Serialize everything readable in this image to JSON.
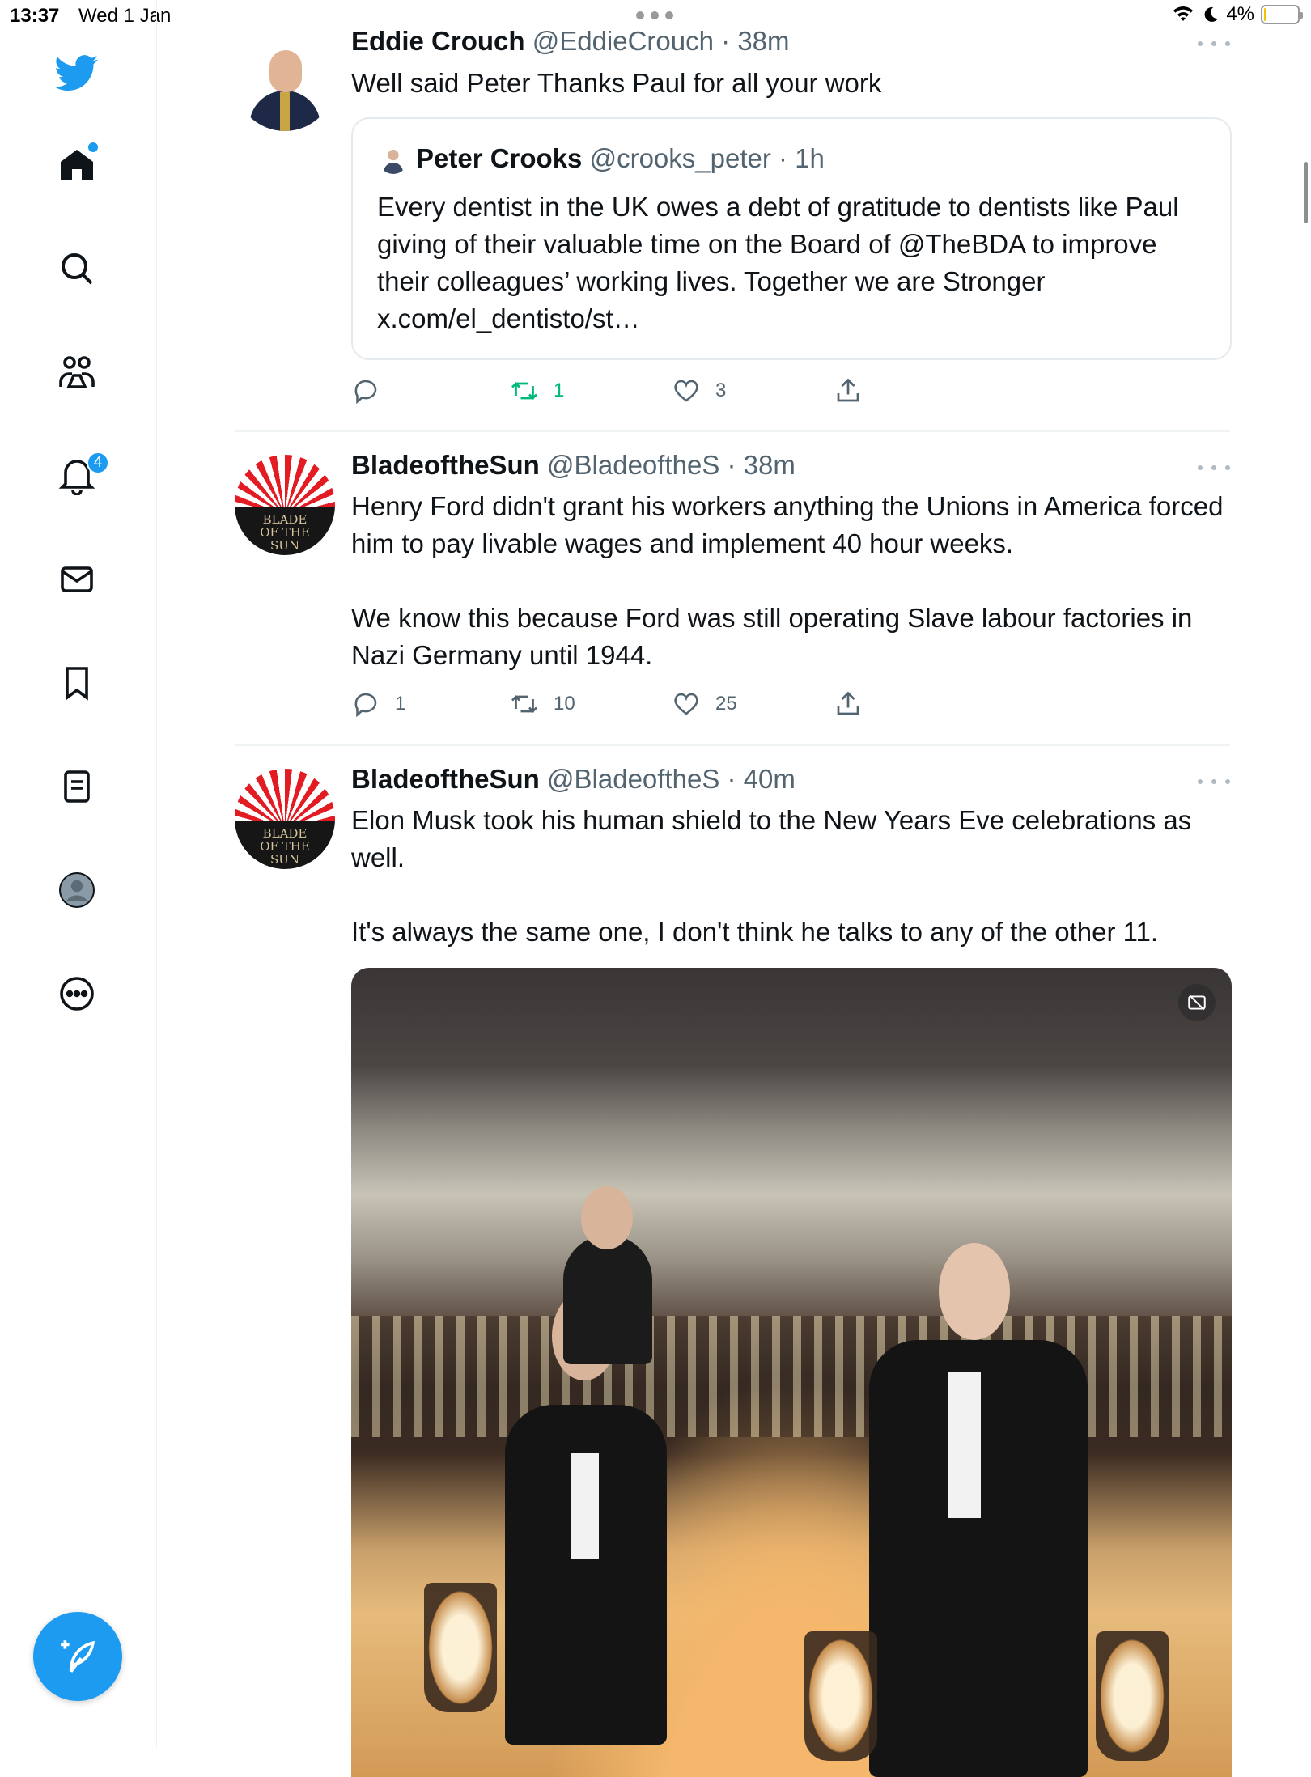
{
  "status_bar": {
    "time": "13:37",
    "date": "Wed 1 Jan",
    "battery": "4%",
    "battery_level": 0.04
  },
  "sidebar": {
    "notifications_badge": "4",
    "items": [
      {
        "name": "home",
        "icon": "home-icon"
      },
      {
        "name": "search",
        "icon": "search-icon"
      },
      {
        "name": "communities",
        "icon": "communities-icon"
      },
      {
        "name": "notifications",
        "icon": "bell-icon"
      },
      {
        "name": "messages",
        "icon": "mail-icon"
      },
      {
        "name": "bookmarks",
        "icon": "bookmark-icon"
      },
      {
        "name": "lists",
        "icon": "list-icon"
      },
      {
        "name": "profile",
        "icon": "profile-icon"
      },
      {
        "name": "more",
        "icon": "more-circle-icon"
      }
    ],
    "compose_icon": "compose-icon"
  },
  "colors": {
    "accent": "#1d9bf0",
    "retweet_active": "#00ba7c",
    "secondary_text": "#536471",
    "divider": "#eff3f4"
  },
  "tweets": [
    {
      "name": "Eddie Crouch",
      "handle": "@EddieCrouch",
      "time": "38m",
      "text": "Well said Peter Thanks Paul for all your work",
      "quote": {
        "name": "Peter Crooks",
        "handle": "@crooks_peter",
        "time": "1h",
        "text": "Every dentist in the UK owes a debt of gratitude to dentists like Paul giving of their valuable time on the Board of @TheBDA to improve their colleagues’ working lives. Together we are Stronger x.com/el_dentisto/st…"
      },
      "replies": "",
      "retweets": "1",
      "likes": "3"
    },
    {
      "name": "BladeoftheSun",
      "handle": "@BladeoftheS",
      "time": "38m",
      "text": "Henry Ford didn't grant his workers anything the Unions in America forced him to pay livable wages and implement 40 hour weeks.\n\nWe know this because Ford was still operating Slave labour factories in Nazi Germany until 1944.",
      "replies": "1",
      "retweets": "10",
      "likes": "25"
    },
    {
      "name": "BladeoftheSun",
      "handle": "@BladeoftheS",
      "time": "40m",
      "text": "Elon Musk took his human shield to the New Years Eve celebrations as well.\n\nIt's always the same one, I don't think he talks to any of the other 11."
    }
  ],
  "separator": " · ",
  "avatar_text": "BLADE OF THE SUN"
}
